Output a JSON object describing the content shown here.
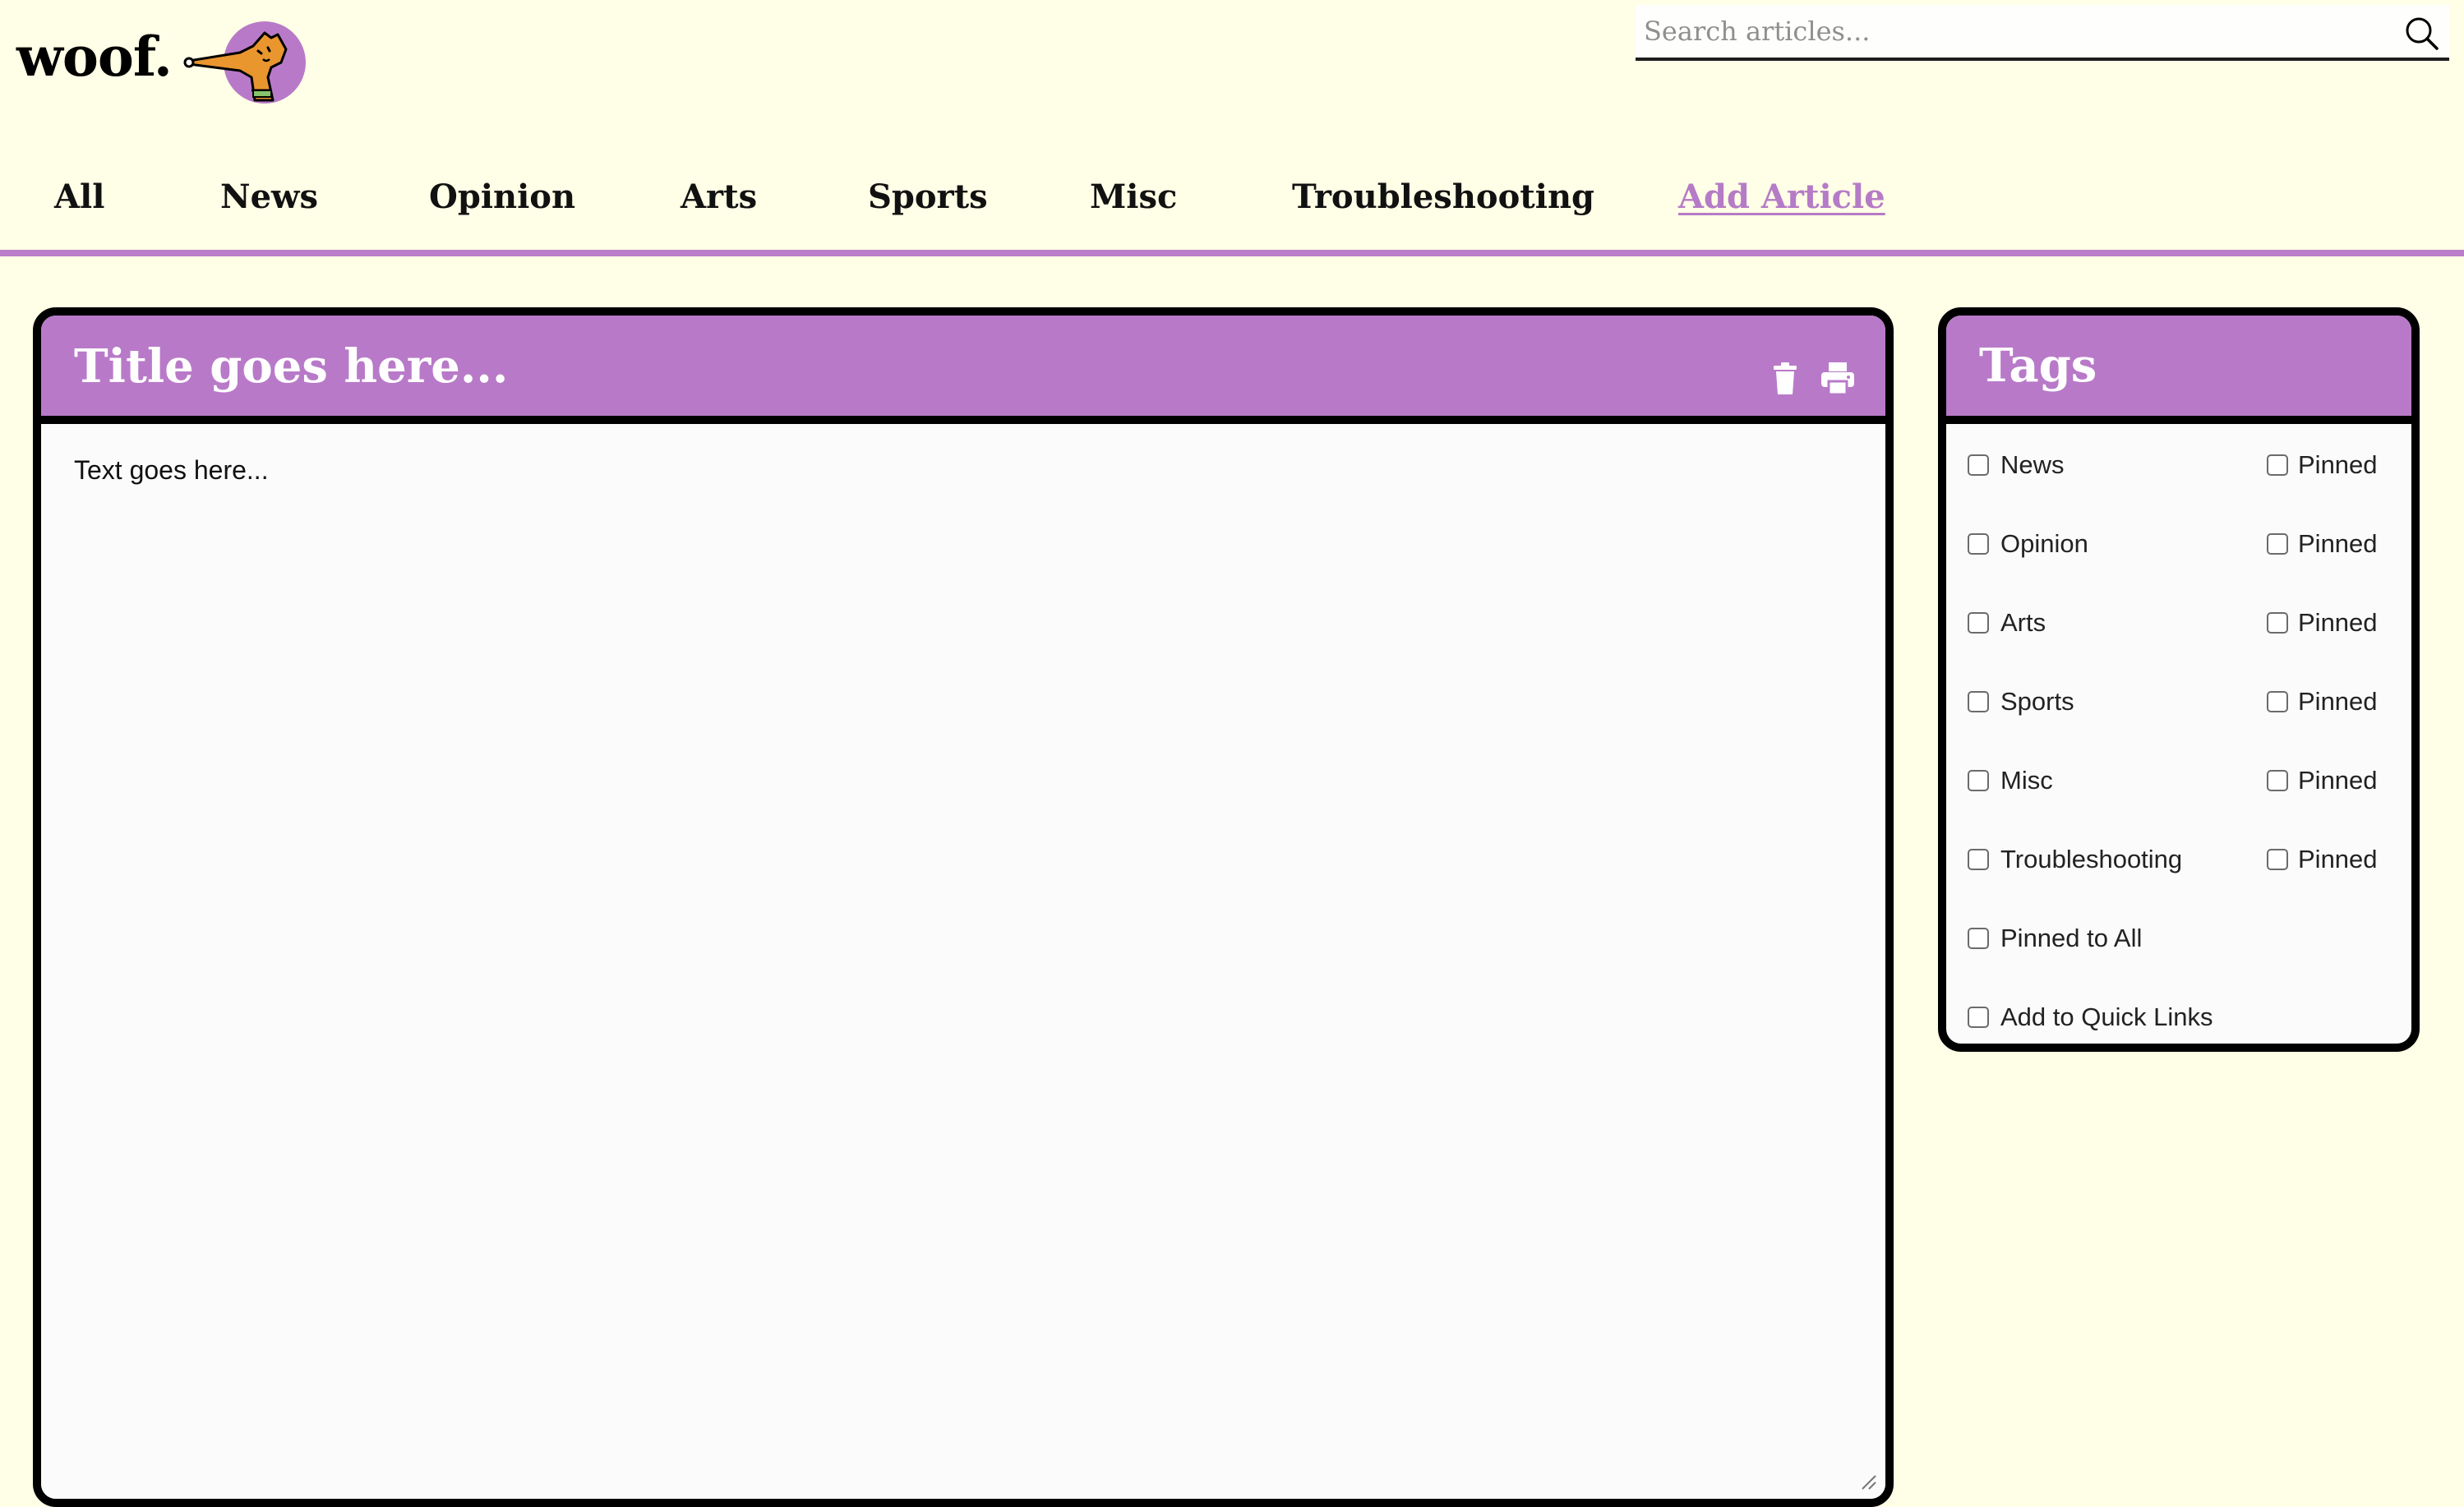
{
  "brand": {
    "name": "woof.",
    "colors": {
      "background": "#fffee6",
      "accent": "#b87ac8",
      "border": "#000000"
    }
  },
  "search": {
    "placeholder": "Search articles...",
    "icon": "search-icon"
  },
  "nav": {
    "items": [
      {
        "label": "All"
      },
      {
        "label": "News"
      },
      {
        "label": "Opinion"
      },
      {
        "label": "Arts"
      },
      {
        "label": "Sports"
      },
      {
        "label": "Misc"
      },
      {
        "label": "Troubleshooting"
      }
    ],
    "add_article": "Add Article"
  },
  "editor": {
    "title_placeholder": "Title goes here...",
    "body_placeholder": "Text goes here...",
    "icons": [
      "trash-icon",
      "printer-icon"
    ]
  },
  "tags": {
    "title": "Tags",
    "items": [
      {
        "label": "News",
        "pinned_label": "Pinned",
        "checked": false,
        "pinned": false
      },
      {
        "label": "Opinion",
        "pinned_label": "Pinned",
        "checked": false,
        "pinned": false
      },
      {
        "label": "Arts",
        "pinned_label": "Pinned",
        "checked": false,
        "pinned": false
      },
      {
        "label": "Sports",
        "pinned_label": "Pinned",
        "checked": false,
        "pinned": false
      },
      {
        "label": "Misc",
        "pinned_label": "Pinned",
        "checked": false,
        "pinned": false
      },
      {
        "label": "Troubleshooting",
        "pinned_label": "Pinned",
        "checked": false,
        "pinned": false
      }
    ],
    "pinned_to_all": {
      "label": "Pinned to All",
      "checked": false
    },
    "quick_links": {
      "label": "Add to Quick Links",
      "checked": false
    }
  }
}
